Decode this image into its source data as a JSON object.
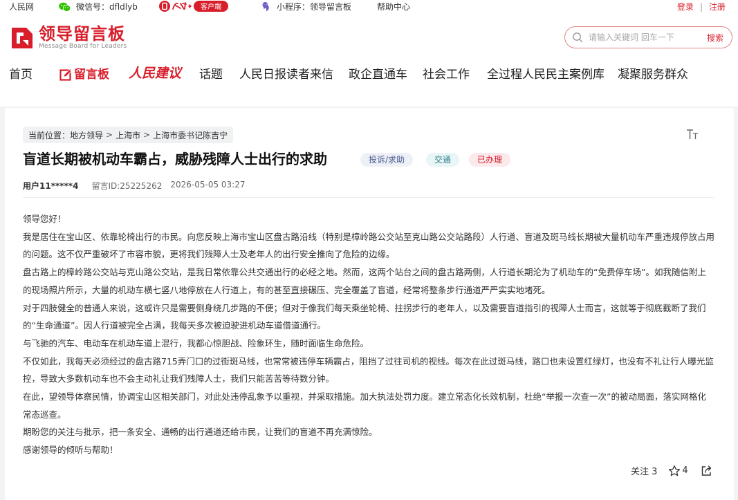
{
  "topbar": {
    "site": "人民网",
    "wechat": "微信号：dfldlyb",
    "app_badge": "客户端",
    "miniprogram": "小程序：领导留言板",
    "help": "帮助中心",
    "login": "登录",
    "separator": "|",
    "register": "注册"
  },
  "header": {
    "logo_cn": "领导留言板",
    "logo_en": "Message Board for Leaders",
    "search_placeholder": "请输入关键词 回车一下",
    "search_button": "搜索"
  },
  "nav": {
    "home": "首页",
    "board": "留言板",
    "jianyi": "人民建议",
    "topics": "话题",
    "letters": "人民日报读者来信",
    "govcar": "政企直通车",
    "social": "社会工作",
    "democracy": "全过程人民民主案例库",
    "gather": "凝聚服务群众"
  },
  "breadcrumb": {
    "label": "当前位置：",
    "items": [
      "地方领导",
      "上海市",
      "上海市委书记陈吉宁"
    ],
    "sep": ">"
  },
  "message": {
    "title": "盲道长期被机动车霸占，威胁残障人士出行的求助",
    "tags": {
      "category": "投诉/求助",
      "field": "交通",
      "status": "已办理"
    },
    "user": "用户11*****4",
    "id": "留言ID:25225262",
    "time": "2026-05-05 03:27",
    "paragraphs": [
      "领导您好！",
      "我是居住在宝山区、依靠轮椅出行的市民。向您反映上海市宝山区盘古路沿线（特别是樟岭路公交站至克山路公交站路段）人行道、盲道及斑马线长期被大量机动车严重违规停放占用的问题。这不仅严重破坏了市容市貌，更将我们残障人士及老年人的出行安全推向了危险的边缘。",
      "盘古路上的樟岭路公交站与克山路公交站，是我日常依靠公共交通出行的必经之地。然而，这两个站台之间的盘古路两侧，人行道长期沦为了机动车的“免费停车场”。如我随信附上的现场照片所示，大量的机动车横七竖八地停放在人行道上，有的甚至直接碾压、完全覆盖了盲道，经常将整条步行通道严严实实地堵死。",
      "对于四肢健全的普通人来说，这或许只是需要侧身绕几步路的不便；但对于像我们每天乘坐轮椅、拄拐步行的老年人，以及需要盲道指引的视障人士而言，这就等于彻底截断了我们的“生命通道”。因人行道被完全占满，我每天多次被迫驶进机动车道借道通行。",
      "与飞驰的汽车、电动车在机动车道上混行，我都心惊胆战、险象环生，随时面临生命危险。",
      "不仅如此，我每天必须经过的盘古路715弄门口的过街斑马线，也常常被违停车辆霸占，阻挡了过往司机的视线。每次在此过斑马线，路口也未设置红绿灯，也没有不礼让行人曝光监控，导致大多数机动车也不会主动礼让我们残障人士，我们只能苦苦等待数分钟。",
      "在此，望领导体察民情，协调宝山区相关部门，对此处违停乱象予以重视，并采取措施。加大执法处罚力度。建立常态化长效机制，杜绝“举报一次查一次”的被动局面，落实网格化常态巡查。",
      "期盼您的关注与批示，把一条安全、通畅的出行通道还给市民，让我们的盲道不再充满惊险。",
      "感谢领导的倾听与帮助！"
    ]
  },
  "actions": {
    "follow": "关注 3",
    "likes": "4"
  },
  "colors": {
    "brand": "#d81e2b",
    "page_bg": "#f2f3f5"
  }
}
